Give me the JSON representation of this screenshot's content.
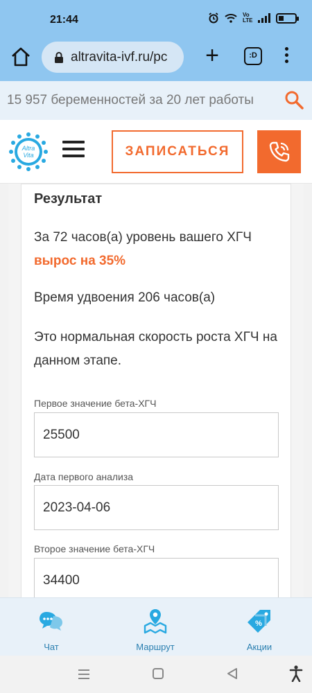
{
  "status_bar": {
    "time": "21:44",
    "icons": [
      "alarm-icon",
      "wifi-icon",
      "volte-icon",
      "signal-icon",
      "battery-icon"
    ],
    "volte_label": "Vo LTE"
  },
  "browser": {
    "url": "altravita-ivf.ru/pc",
    "tabs_label": ":D"
  },
  "promo": {
    "text": "15 957 беременностей за 20 лет работы"
  },
  "header": {
    "logo_line1": "Altra",
    "logo_line2": "Vita",
    "signup_label": "ЗАПИСАТЬСЯ"
  },
  "result": {
    "title": "Результат",
    "line1": "За 72 часов(а) уровень вашего ХГЧ",
    "growth": "вырос на 35%",
    "doubling": "Время удвоения 206 часов(а)",
    "note": "Это нормальная скорость роста ХГЧ на данном этапе."
  },
  "form": {
    "fields": [
      {
        "label": "Первое значение бета-ХГЧ",
        "value": "25500"
      },
      {
        "label": "Дата первого анализа",
        "value": "2023-04-06"
      },
      {
        "label": "Второе значение бета-ХГЧ",
        "value": "34400"
      }
    ]
  },
  "bottom_nav": {
    "items": [
      {
        "label": "Чат",
        "icon": "chat-icon"
      },
      {
        "label": "Маршрут",
        "icon": "map-pin-icon"
      },
      {
        "label": "Акции",
        "icon": "discount-tag-icon"
      }
    ]
  },
  "colors": {
    "accent": "#f26a2e",
    "browser_bar": "#8fc6f0",
    "nav_blue": "#2a7fb0"
  }
}
